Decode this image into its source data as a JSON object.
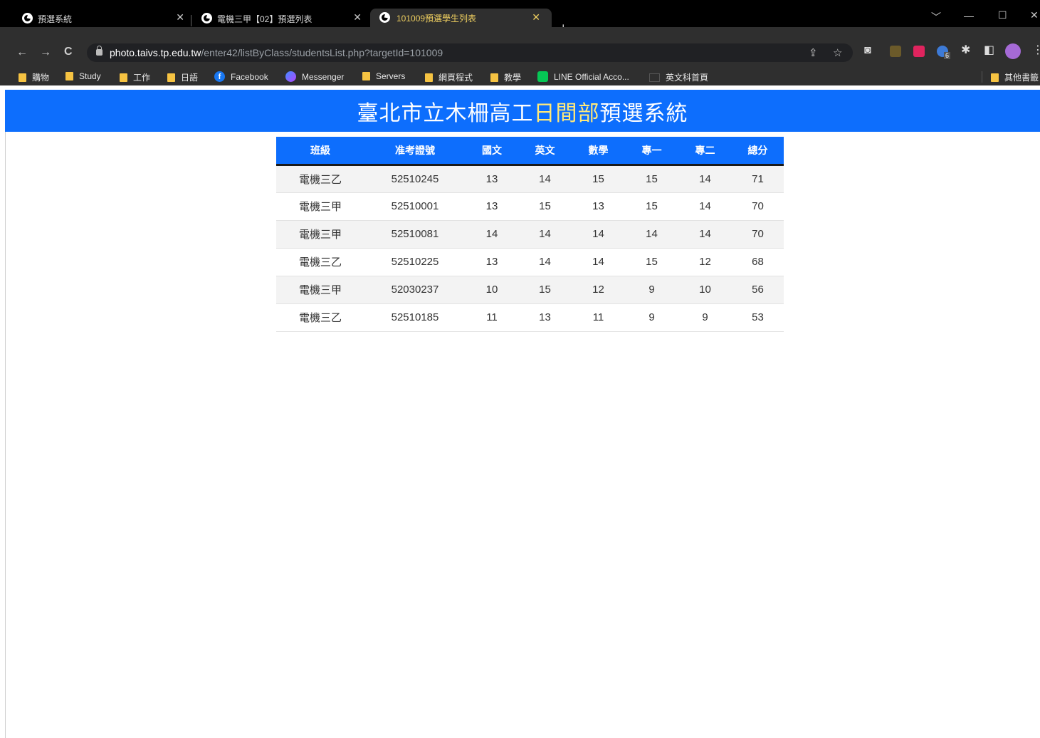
{
  "browser": {
    "tabs": [
      {
        "title": "預選系統",
        "active": false
      },
      {
        "title": "電機三甲【02】預選列表",
        "active": false
      },
      {
        "title": "101009預選學生列表",
        "active": true
      }
    ],
    "new_tab_label": "+",
    "address": {
      "host": "photo.taivs.tp.edu.tw",
      "path": "/enter42/listByClass/studentsList.php?targetId=101009"
    },
    "bookmarks": [
      {
        "label": "購物",
        "icon": "folder-icon"
      },
      {
        "label": "Study",
        "icon": "folder-icon"
      },
      {
        "label": "工作",
        "icon": "folder-icon"
      },
      {
        "label": "日語",
        "icon": "folder-icon"
      },
      {
        "label": "Facebook",
        "icon": "facebook-icon"
      },
      {
        "label": "Messenger",
        "icon": "messenger-icon"
      },
      {
        "label": "Servers",
        "icon": "folder-icon"
      },
      {
        "label": "網頁程式",
        "icon": "folder-icon"
      },
      {
        "label": "教學",
        "icon": "folder-icon"
      },
      {
        "label": "LINE Official Acco...",
        "icon": "line-icon"
      },
      {
        "label": "英文科首頁",
        "icon": "page-icon"
      }
    ],
    "other_bookmarks": "其他書籤",
    "extension_badge": "6"
  },
  "page": {
    "title_pre": "臺北市立木柵高工",
    "title_accent": "日間部",
    "title_post": "預選系統",
    "colors": {
      "header": "#0d6efd",
      "accent": "#ffe97a"
    }
  },
  "table": {
    "headers": [
      "班級",
      "准考證號",
      "國文",
      "英文",
      "數學",
      "專一",
      "專二",
      "總分"
    ],
    "rows": [
      [
        "電機三乙",
        "52510245",
        "13",
        "14",
        "15",
        "15",
        "14",
        "71"
      ],
      [
        "電機三甲",
        "52510001",
        "13",
        "15",
        "13",
        "15",
        "14",
        "70"
      ],
      [
        "電機三甲",
        "52510081",
        "14",
        "14",
        "14",
        "14",
        "14",
        "70"
      ],
      [
        "電機三乙",
        "52510225",
        "13",
        "14",
        "14",
        "15",
        "12",
        "68"
      ],
      [
        "電機三甲",
        "52030237",
        "10",
        "15",
        "12",
        "9",
        "10",
        "56"
      ],
      [
        "電機三乙",
        "52510185",
        "11",
        "13",
        "11",
        "9",
        "9",
        "53"
      ]
    ]
  }
}
